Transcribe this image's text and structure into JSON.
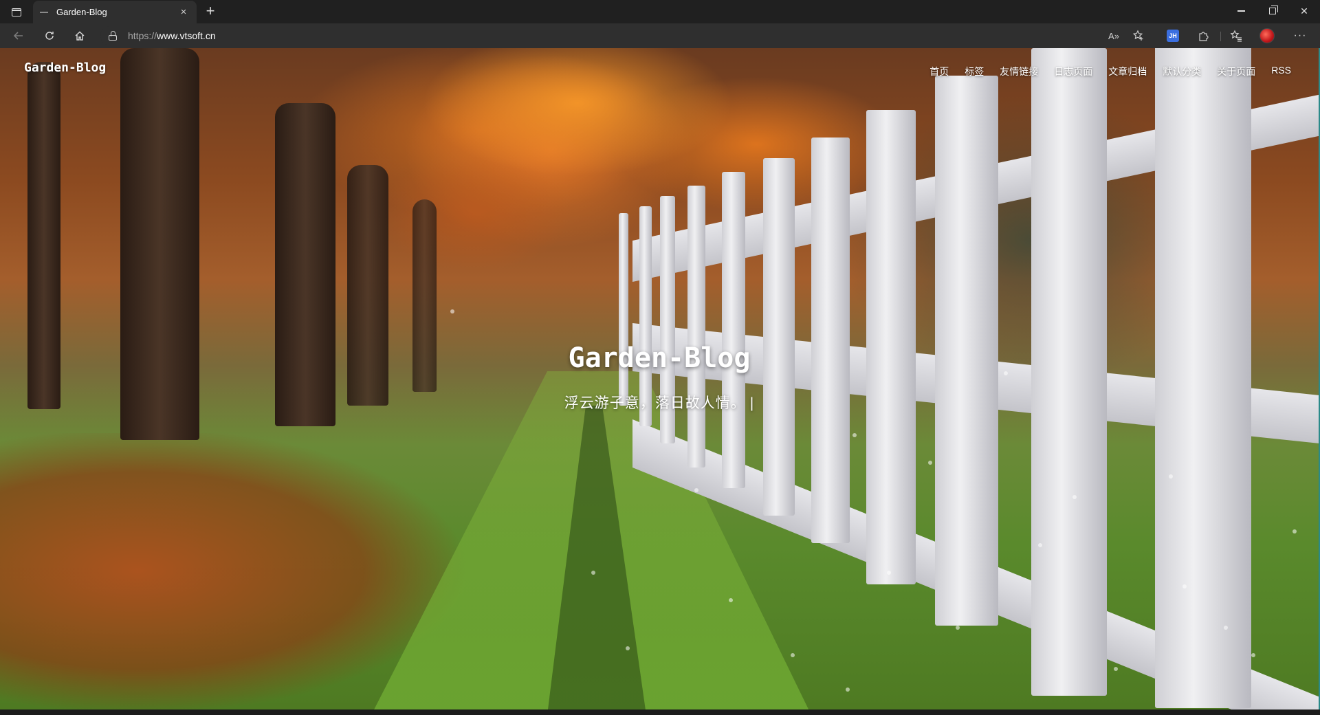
{
  "browser": {
    "tab_title": "Garden-Blog",
    "tab_close": "×",
    "new_tab": "+",
    "url_scheme": "https://",
    "url_host": "www.vtsoft.cn",
    "read_aloud": "A»",
    "extension_badge": "JH",
    "more": "···",
    "icons": {
      "back": "arrow-left-icon",
      "reload": "reload-icon",
      "home": "home-icon",
      "lock": "lock-icon",
      "favorite_add": "star-plus-icon",
      "extensions": "puzzle-icon",
      "favorites": "favorites-icon",
      "profile": "avatar"
    }
  },
  "site": {
    "brand": "Garden-Blog",
    "menu": [
      {
        "label": "首页"
      },
      {
        "label": "标签"
      },
      {
        "label": "友情链接"
      },
      {
        "label": "日志页面"
      },
      {
        "label": "文章归档"
      },
      {
        "label": "默认分类"
      },
      {
        "label": "关于页面"
      },
      {
        "label": "RSS"
      }
    ],
    "hero_title": "Garden-Blog",
    "hero_subtitle": "浮云游子意，落日故人情。",
    "caret": "|"
  },
  "colors": {
    "chrome_dark": "#202020",
    "chrome_toolbar": "#2f2f2f",
    "accent_ext": "#3b6fe0",
    "scrollbar": "#2a8a8a"
  }
}
